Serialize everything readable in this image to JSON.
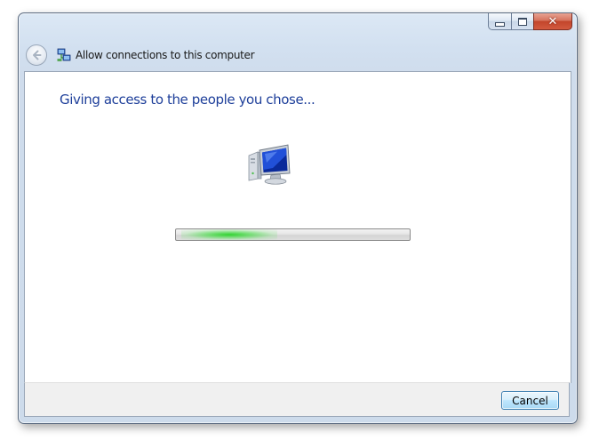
{
  "window": {
    "title": "Allow connections to this computer",
    "caption_buttons": {
      "minimize": "minimize",
      "maximize": "maximize",
      "close": "✕"
    }
  },
  "main": {
    "heading": "Giving access to the people you chose...",
    "icon": "computer-monitor-icon",
    "progress": {
      "state": "indeterminate",
      "glow_position_fraction": 0.27
    }
  },
  "footer": {
    "cancel_label": "Cancel"
  },
  "colors": {
    "heading": "#1e3f9a",
    "progress_glow": "#28d228",
    "close_button": "#c2452b",
    "button_border": "#3c7fb1"
  }
}
